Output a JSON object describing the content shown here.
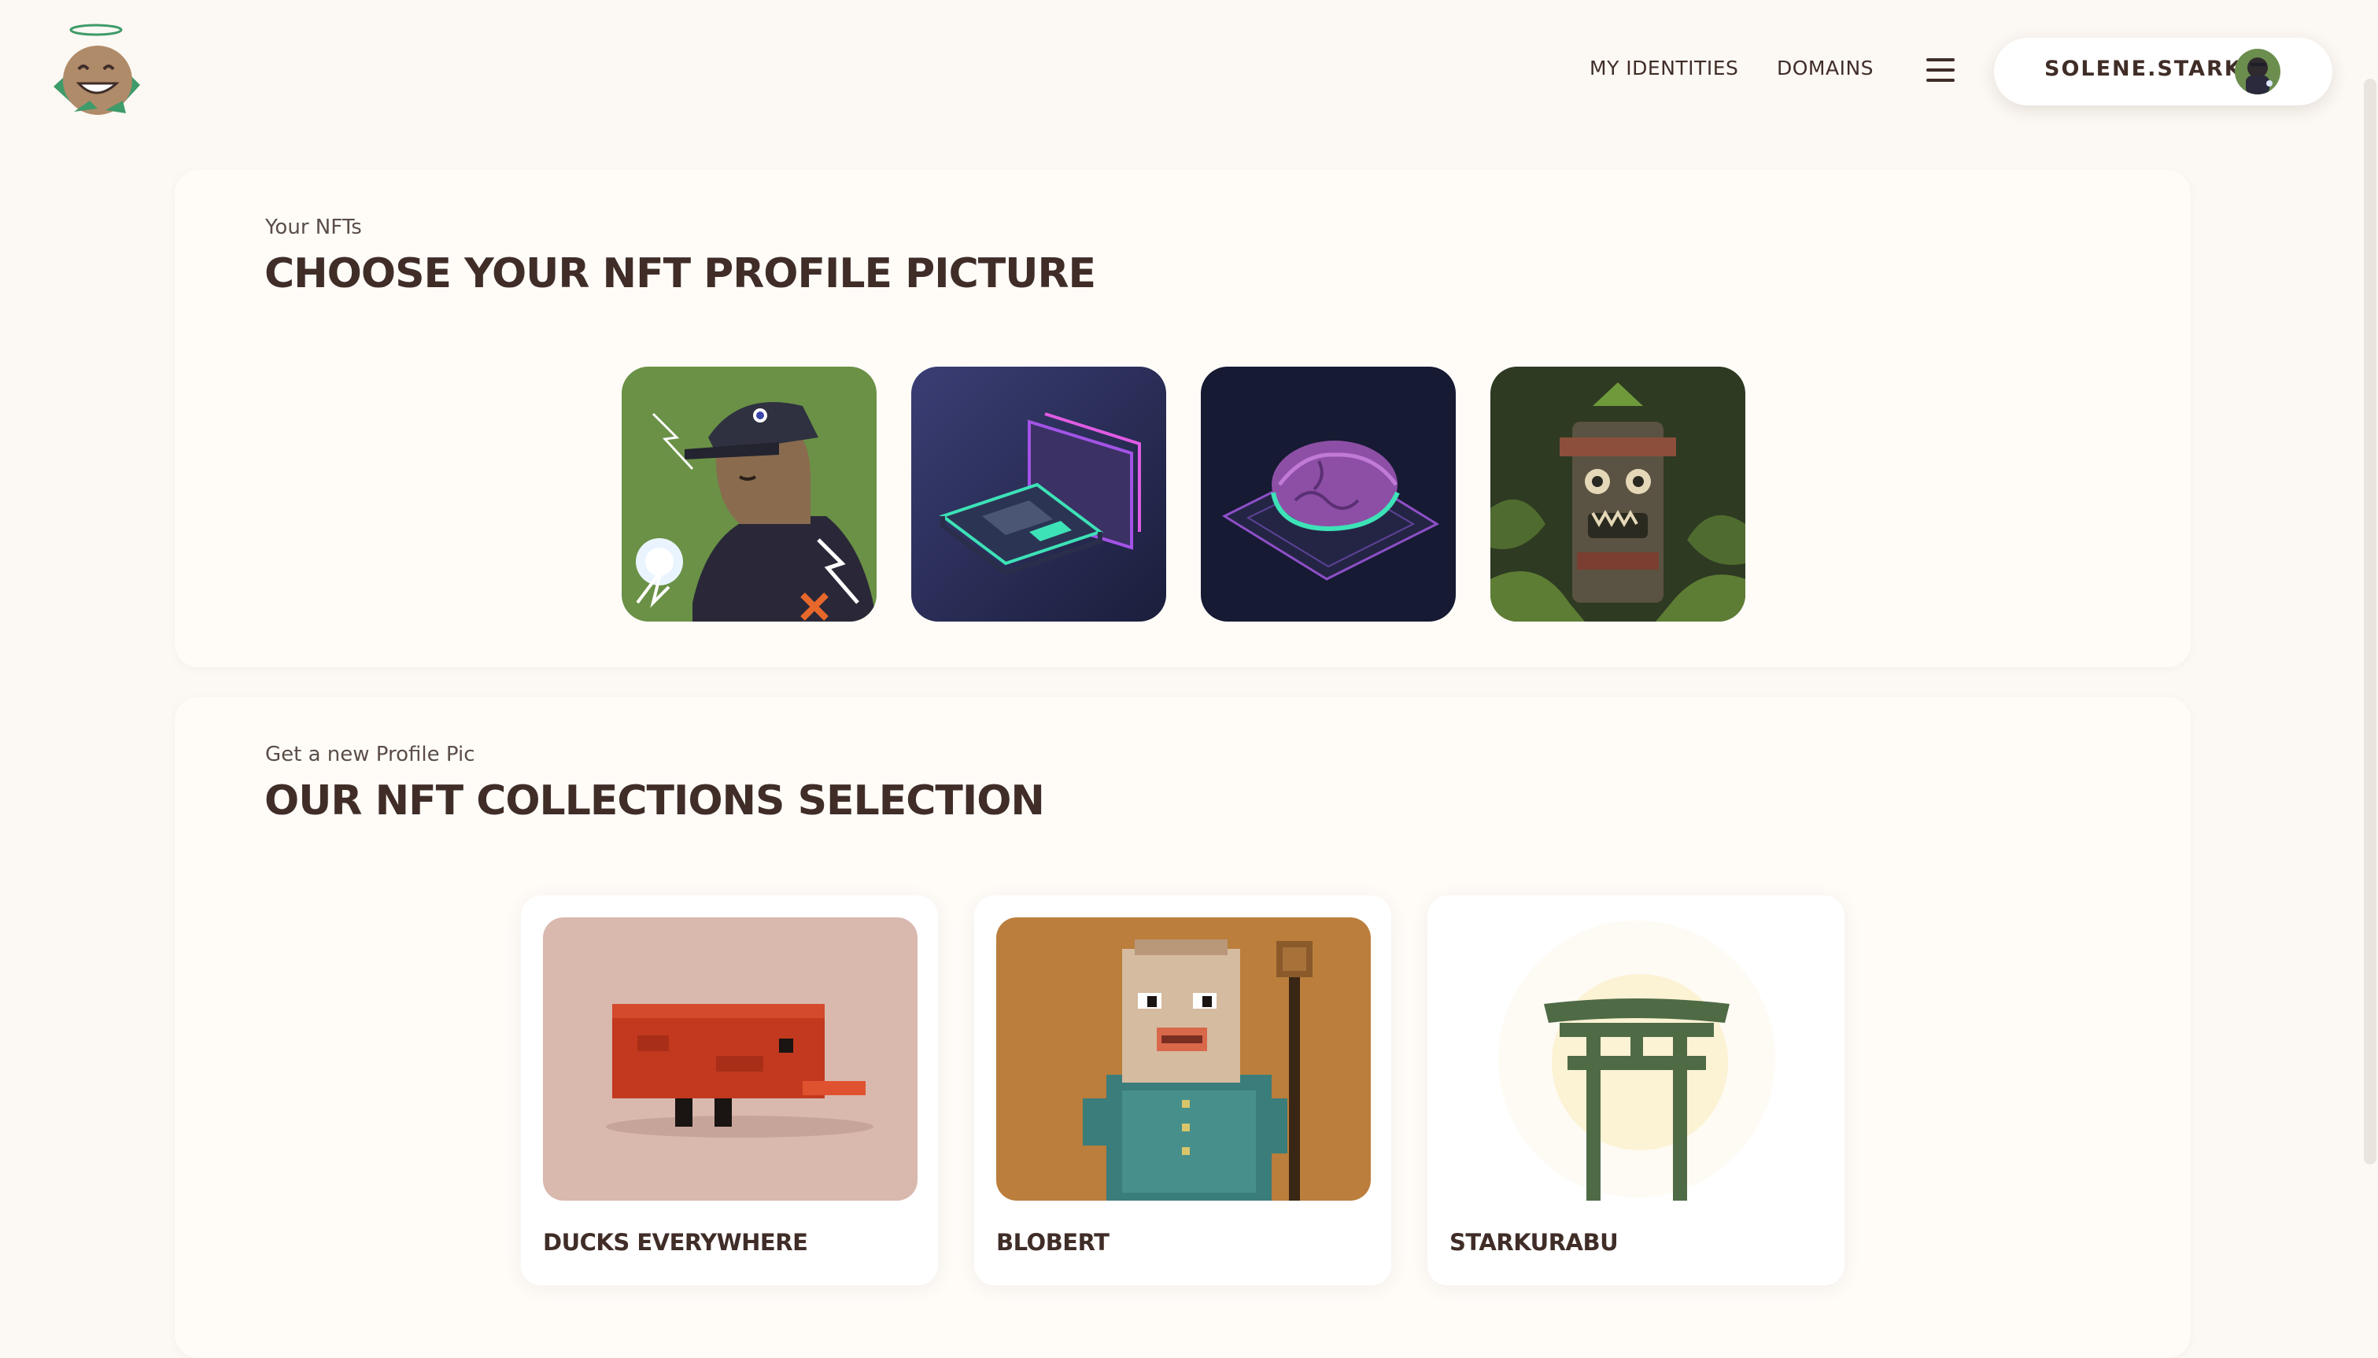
{
  "nav": {
    "logo_icon": "starknet-id-mascot-logo",
    "links": [
      "MY IDENTITIES",
      "DOMAINS"
    ],
    "menu_icon": "hamburger-menu-icon",
    "user": {
      "name": "SOLENE.STARK",
      "avatar_icon": "user-avatar"
    }
  },
  "nft_section": {
    "subtitle": "Your NFTs",
    "title": "CHOOSE YOUR NFT PROFILE PICTURE",
    "nfts": [
      {
        "icon": "nft-lightning-character"
      },
      {
        "icon": "nft-isometric-wallet"
      },
      {
        "icon": "nft-isometric-brain"
      },
      {
        "icon": "nft-jungle-totem"
      }
    ]
  },
  "collections_section": {
    "subtitle": "Get a new Profile Pic",
    "title": "OUR NFT COLLECTIONS SELECTION",
    "collections": [
      {
        "name": "DUCKS EVERYWHERE",
        "icon": "pixel-duck-icon"
      },
      {
        "name": "BLOBERT",
        "icon": "pixel-blobert-icon"
      },
      {
        "name": "STARKURABU",
        "icon": "torii-gate-icon"
      }
    ]
  },
  "colors": {
    "background": "#FCF8F3",
    "card": "#FFFCF8",
    "text": "#402D28",
    "accent_green": "#6A8F4A"
  }
}
